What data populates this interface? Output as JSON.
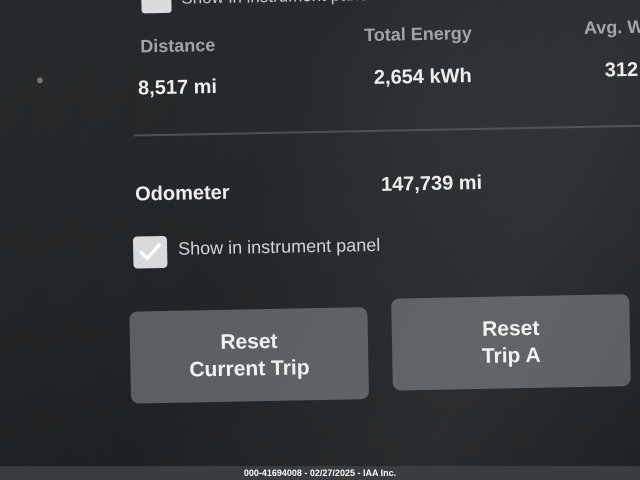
{
  "top_row": {
    "checkbox_label": "Show in instrument panel"
  },
  "trip_stats": {
    "distance_label": "Distance",
    "distance_value": "8,517 mi",
    "energy_label": "Total Energy",
    "energy_value": "2,654 kWh",
    "avg_label": "Avg. W",
    "avg_value": "312"
  },
  "odometer": {
    "label": "Odometer",
    "value": "147,739 mi"
  },
  "instrument_panel": {
    "checked": true,
    "label": "Show in instrument panel"
  },
  "buttons": {
    "reset_current_line1": "Reset",
    "reset_current_line2": "Current Trip",
    "reset_a_line1": "Reset",
    "reset_a_line2": "Trip A"
  },
  "footer": {
    "text": "000-41694008 - 02/27/2025 - IAA Inc."
  },
  "colors": {
    "background": "#232628",
    "button": "#5a5f62",
    "label_gray": "#9da4a8",
    "value_white": "#eceeef"
  }
}
